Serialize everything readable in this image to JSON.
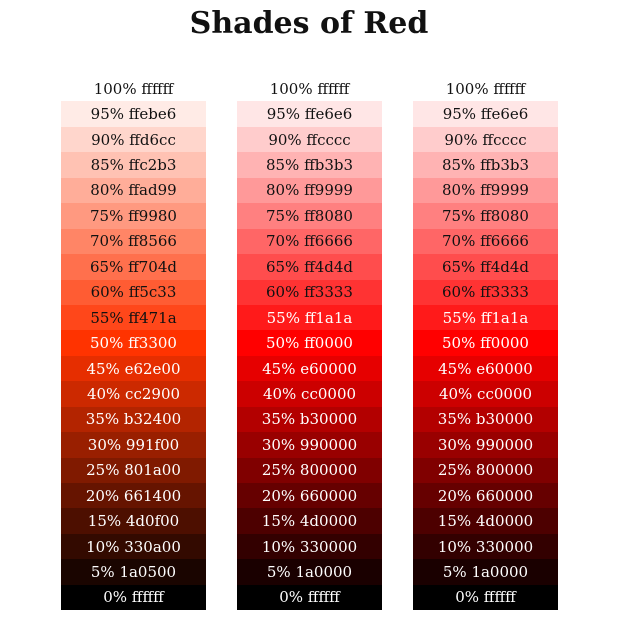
{
  "title": "Shades of Red",
  "columns": [
    {
      "swatches": [
        {
          "label": "100% ffffff",
          "color": "#ffffff"
        },
        {
          "label": "95% ffebe6",
          "color": "#ffebe6"
        },
        {
          "label": "90% ffd6cc",
          "color": "#ffd6cc"
        },
        {
          "label": "85% ffc2b3",
          "color": "#ffc2b3"
        },
        {
          "label": "80% ffad99",
          "color": "#ffad99"
        },
        {
          "label": "75% ff9980",
          "color": "#ff9980"
        },
        {
          "label": "70% ff8566",
          "color": "#ff8566"
        },
        {
          "label": "65% ff704d",
          "color": "#ff704d"
        },
        {
          "label": "60% ff5c33",
          "color": "#ff5c33"
        },
        {
          "label": "55% ff471a",
          "color": "#ff471a"
        },
        {
          "label": "50% ff3300",
          "color": "#ff3300"
        },
        {
          "label": "45% e62e00",
          "color": "#e62e00"
        },
        {
          "label": "40% cc2900",
          "color": "#cc2900"
        },
        {
          "label": "35% b32400",
          "color": "#b32400"
        },
        {
          "label": "30% 991f00",
          "color": "#991f00"
        },
        {
          "label": "25% 801a00",
          "color": "#801a00"
        },
        {
          "label": "20% 661400",
          "color": "#661400"
        },
        {
          "label": "15% 4d0f00",
          "color": "#4d0f00"
        },
        {
          "label": "10% 330a00",
          "color": "#330a00"
        },
        {
          "label": "5% 1a0500",
          "color": "#1a0500"
        },
        {
          "label": "0% ffffff",
          "color": "#000000"
        }
      ]
    },
    {
      "swatches": [
        {
          "label": "100% ffffff",
          "color": "#ffffff"
        },
        {
          "label": "95% ffe6e6",
          "color": "#ffe6e6"
        },
        {
          "label": "90% ffcccc",
          "color": "#ffcccc"
        },
        {
          "label": "85% ffb3b3",
          "color": "#ffb3b3"
        },
        {
          "label": "80% ff9999",
          "color": "#ff9999"
        },
        {
          "label": "75% ff8080",
          "color": "#ff8080"
        },
        {
          "label": "70% ff6666",
          "color": "#ff6666"
        },
        {
          "label": "65% ff4d4d",
          "color": "#ff4d4d"
        },
        {
          "label": "60% ff3333",
          "color": "#ff3333"
        },
        {
          "label": "55% ff1a1a",
          "color": "#ff1a1a"
        },
        {
          "label": "50% ff0000",
          "color": "#ff0000"
        },
        {
          "label": "45% e60000",
          "color": "#e60000"
        },
        {
          "label": "40% cc0000",
          "color": "#cc0000"
        },
        {
          "label": "35% b30000",
          "color": "#b30000"
        },
        {
          "label": "30% 990000",
          "color": "#990000"
        },
        {
          "label": "25% 800000",
          "color": "#800000"
        },
        {
          "label": "20% 660000",
          "color": "#660000"
        },
        {
          "label": "15% 4d0000",
          "color": "#4d0000"
        },
        {
          "label": "10% 330000",
          "color": "#330000"
        },
        {
          "label": "5% 1a0000",
          "color": "#1a0000"
        },
        {
          "label": "0% ffffff",
          "color": "#000000"
        }
      ]
    },
    {
      "swatches": [
        {
          "label": "100% ffffff",
          "color": "#ffffff"
        },
        {
          "label": "95% ffe6e6",
          "color": "#ffe6e6"
        },
        {
          "label": "90% ffcccc",
          "color": "#ffcccc"
        },
        {
          "label": "85% ffb3b3",
          "color": "#ffb3b3"
        },
        {
          "label": "80% ff9999",
          "color": "#ff9999"
        },
        {
          "label": "75% ff8080",
          "color": "#ff8080"
        },
        {
          "label": "70% ff6666",
          "color": "#ff6666"
        },
        {
          "label": "65% ff4d4d",
          "color": "#ff4d4d"
        },
        {
          "label": "60% ff3333",
          "color": "#ff3333"
        },
        {
          "label": "55% ff1a1a",
          "color": "#ff1a1a"
        },
        {
          "label": "50% ff0000",
          "color": "#ff0000"
        },
        {
          "label": "45% e60000",
          "color": "#e60000"
        },
        {
          "label": "40% cc0000",
          "color": "#cc0000"
        },
        {
          "label": "35% b30000",
          "color": "#b30000"
        },
        {
          "label": "30% 990000",
          "color": "#990000"
        },
        {
          "label": "25% 800000",
          "color": "#800000"
        },
        {
          "label": "20% 660000",
          "color": "#660000"
        },
        {
          "label": "15% 4d0000",
          "color": "#4d0000"
        },
        {
          "label": "10% 330000",
          "color": "#330000"
        },
        {
          "label": "5% 1a0000",
          "color": "#1a0000"
        },
        {
          "label": "0% ffffff",
          "color": "#000000"
        }
      ]
    }
  ]
}
